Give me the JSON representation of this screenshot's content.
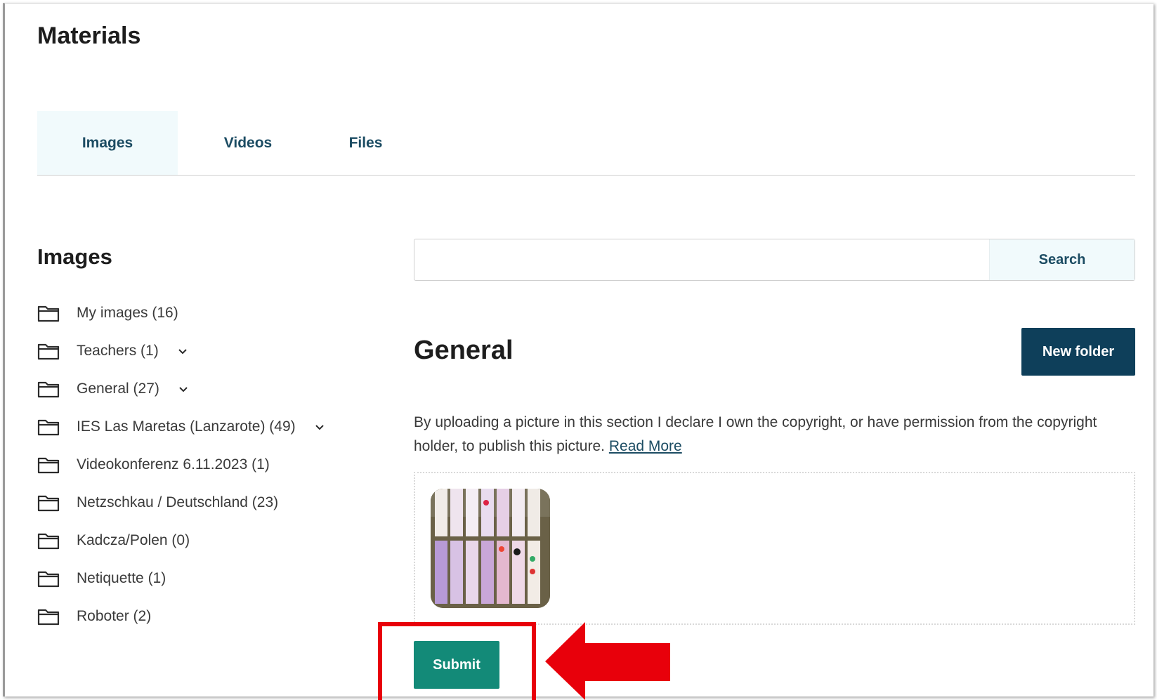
{
  "page": {
    "title": "Materials"
  },
  "tabs": [
    {
      "label": "Images",
      "active": true
    },
    {
      "label": "Videos",
      "active": false
    },
    {
      "label": "Files",
      "active": false
    }
  ],
  "sidebar": {
    "title": "Images",
    "folders": [
      {
        "label": "My images (16)",
        "expandable": false
      },
      {
        "label": "Teachers (1)",
        "expandable": true
      },
      {
        "label": "General (27)",
        "expandable": true
      },
      {
        "label": "IES Las Maretas (Lanzarote) (49)",
        "expandable": true
      },
      {
        "label": "Videokonferenz 6.11.2023 (1)",
        "expandable": false
      },
      {
        "label": "Netzschkau / Deutschland (23)",
        "expandable": false
      },
      {
        "label": "Kadcza/Polen (0)",
        "expandable": false
      },
      {
        "label": "Netiquette (1)",
        "expandable": false
      },
      {
        "label": "Roboter (2)",
        "expandable": false
      }
    ]
  },
  "search": {
    "value": "",
    "placeholder": "",
    "button_label": "Search"
  },
  "main": {
    "section_title": "General",
    "new_folder_label": "New folder",
    "notice_text": "By uploading a picture in this section I declare I own the copyright, or have permission from the copyright holder, to publish this picture.",
    "notice_link": "Read More",
    "submit_label": "Submit"
  },
  "colors": {
    "accent_dark": "#0e3f5a",
    "tab_text": "#1c4c63",
    "submit_green": "#138a78",
    "highlight_red": "#e8000b"
  },
  "icons": [
    "folder-icon",
    "chevron-down-icon",
    "arrow-left-icon"
  ]
}
